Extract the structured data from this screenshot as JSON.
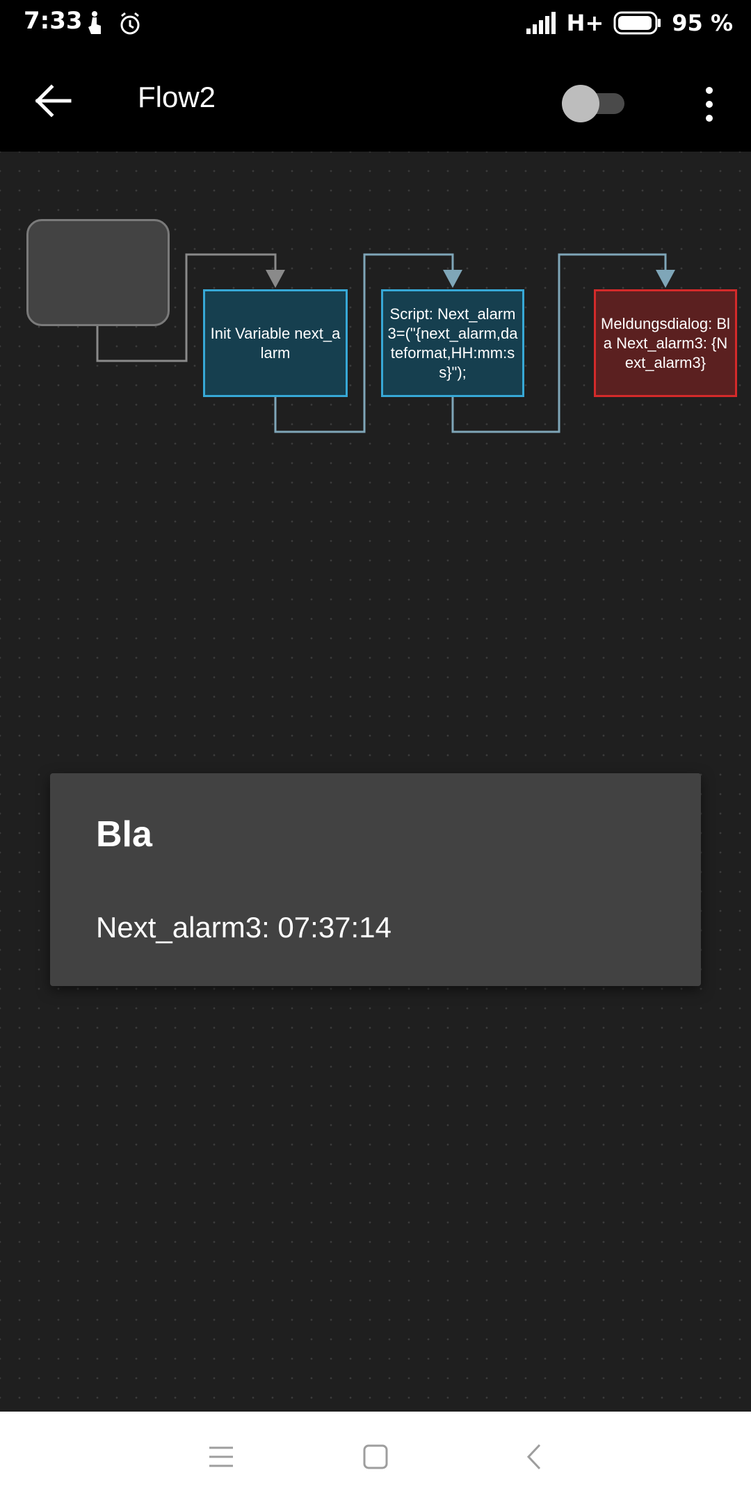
{
  "status_bar": {
    "time": "7:33",
    "network": "H+",
    "battery_percent": "95 %",
    "battery_level": 0.95,
    "icons": [
      "touch-icon",
      "alarm-icon",
      "signal-icon",
      "battery-icon"
    ]
  },
  "app_bar": {
    "title": "Flow2",
    "toggle_on": false,
    "icons": [
      "back-arrow-icon",
      "more-vert-icon"
    ]
  },
  "flow": {
    "nodes": [
      {
        "id": "start",
        "label": ""
      },
      {
        "id": "init",
        "label": "Init Variable next_alarm"
      },
      {
        "id": "script",
        "label": "Script: Next_alarm3=(\"{next_alarm,dateformat,HH:mm:ss}\");"
      },
      {
        "id": "dialog",
        "label": "Meldungsdialog: Bla Next_alarm3: {Next_alarm3}"
      }
    ],
    "colors": {
      "action_border": "#37a8d6",
      "action_fill": "#163f4f",
      "error_border": "#d42a2a",
      "error_fill": "#5b2020",
      "connector_gray": "#8a8a8a",
      "connector_blue": "#7fa6b8"
    }
  },
  "dialog": {
    "title": "Bla",
    "message": "Next_alarm3: 07:37:14"
  },
  "nav_bar": {
    "icons": [
      "menu-icon",
      "home-icon",
      "back-icon"
    ]
  }
}
